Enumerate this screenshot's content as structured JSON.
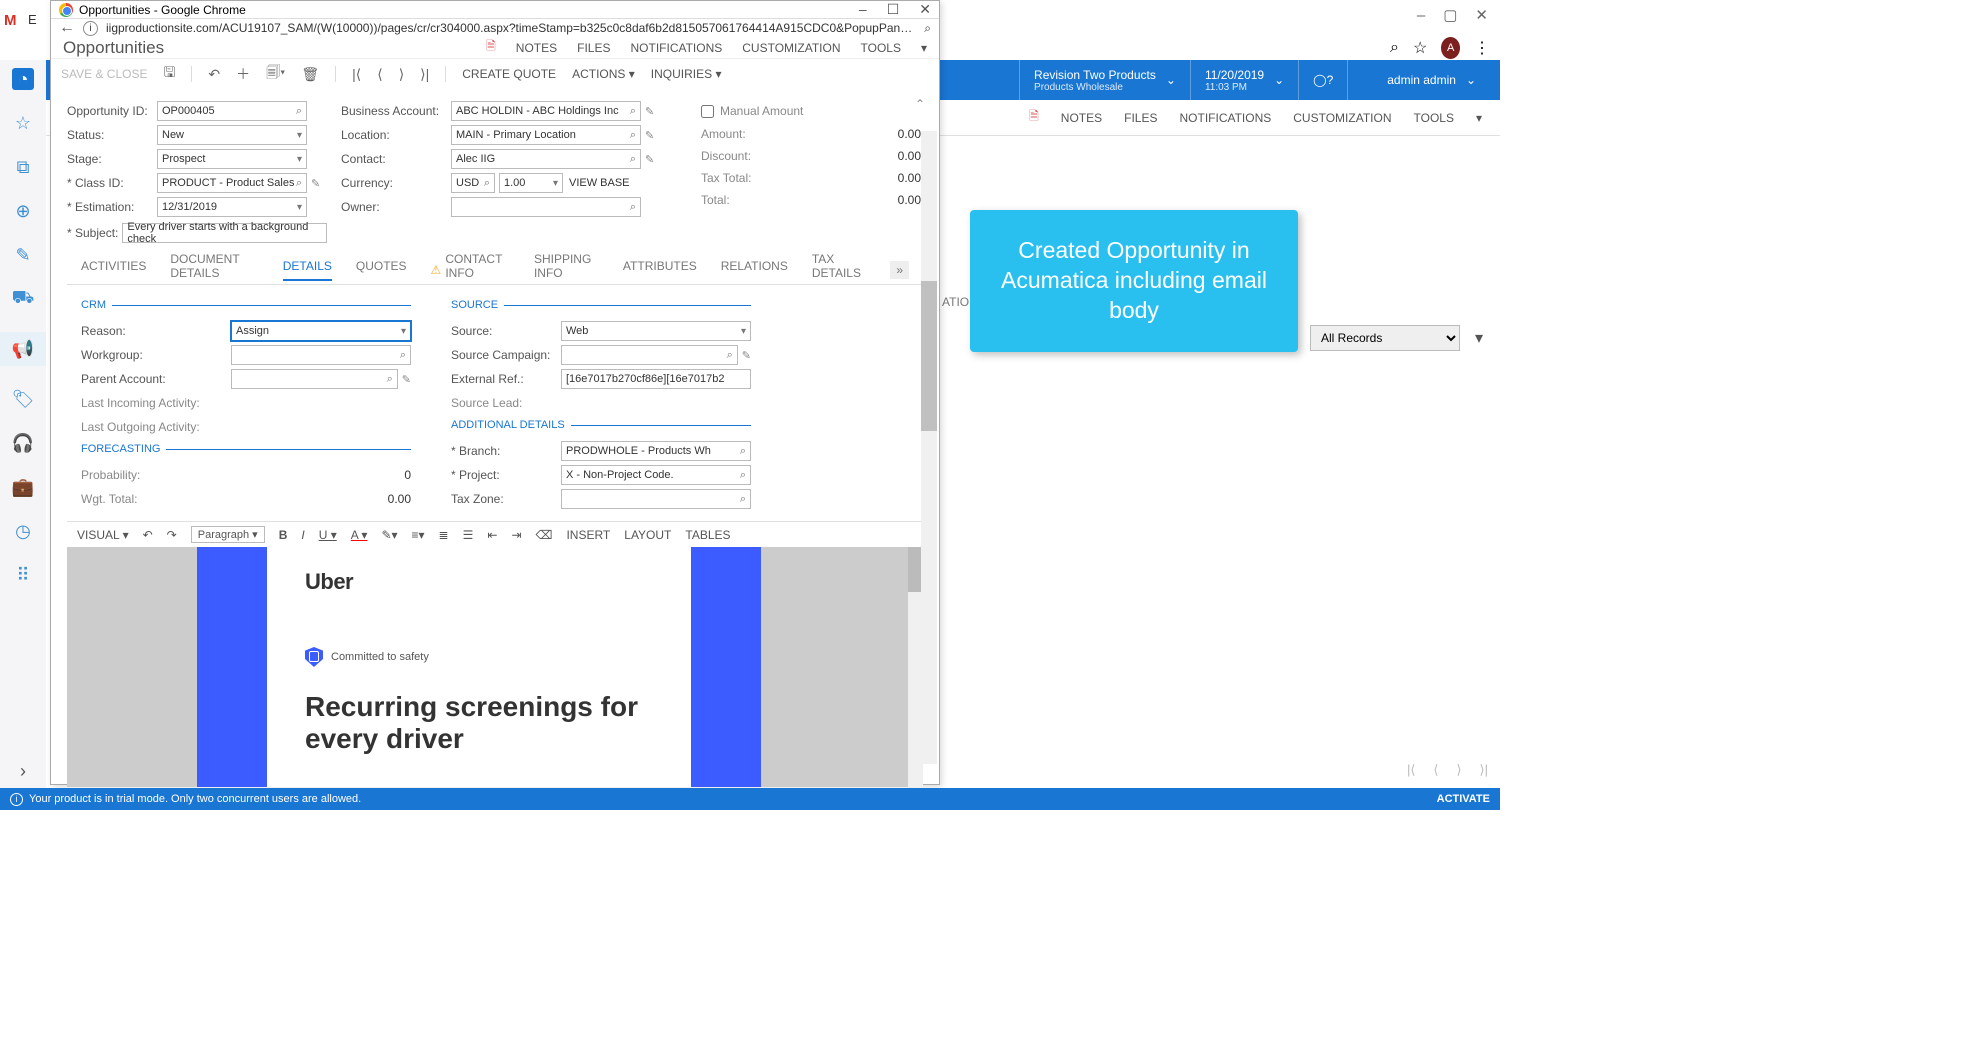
{
  "bg": {
    "company_name": "Revision Two Products",
    "company_sub": "Products Wholesale",
    "date": "11/20/2019",
    "time": "11:03 PM",
    "user": "admin admin",
    "tabs": {
      "notes": "NOTES",
      "files": "FILES",
      "notifications": "NOTIFICATIONS",
      "customization": "CUSTOMIZATION",
      "tools": "TOOLS"
    },
    "filter_all": "All Records",
    "ations": "ATIONS"
  },
  "gmail": {
    "m": "M",
    "e": "E"
  },
  "popup": {
    "title": "Opportunities - Google Chrome",
    "url": "iigproductionsite.com/ACU19107_SAM/(W(10000))/pages/cr/cr304000.aspx?timeStamp=b325c0c8daf6b2d815057061764414A915CDC0&PopupPanel=..."
  },
  "screen": {
    "title": "Opportunities",
    "links": {
      "notes": "NOTES",
      "files": "FILES",
      "notifications": "NOTIFICATIONS",
      "customization": "CUSTOMIZATION",
      "tools": "TOOLS"
    }
  },
  "toolbar": {
    "save_close": "SAVE & CLOSE",
    "create_quote": "CREATE QUOTE",
    "actions": "ACTIONS",
    "inquiries": "INQUIRIES"
  },
  "form": {
    "labels": {
      "opp_id": "Opportunity ID:",
      "status": "Status:",
      "stage": "Stage:",
      "class_id": "* Class ID:",
      "estimation": "* Estimation:",
      "subject": "* Subject:",
      "biz_acct": "Business Account:",
      "location": "Location:",
      "contact": "Contact:",
      "currency": "Currency:",
      "owner": "Owner:",
      "manual": "Manual Amount",
      "amount": "Amount:",
      "discount": "Discount:",
      "tax_total": "Tax Total:",
      "total": "Total:",
      "view_base": "VIEW BASE"
    },
    "values": {
      "opp_id": "OP000405",
      "status": "New",
      "stage": "Prospect",
      "class_id": "PRODUCT - Product Sales O",
      "estimation": "12/31/2019",
      "subject": "Every driver starts with a background check",
      "biz_acct": "ABC HOLDIN - ABC Holdings Inc",
      "location": "MAIN - Primary Location",
      "contact": "Alec IIG",
      "currency": "USD",
      "rate": "1.00",
      "amount": "0.00",
      "discount": "0.00",
      "tax_total": "0.00",
      "total": "0.00"
    }
  },
  "tabs": {
    "activities": "ACTIVITIES",
    "doc_details": "DOCUMENT DETAILS",
    "details": "DETAILS",
    "quotes": "QUOTES",
    "contact_info": "CONTACT INFO",
    "shipping": "SHIPPING INFO",
    "attributes": "ATTRIBUTES",
    "relations": "RELATIONS",
    "tax_details": "TAX DETAILS"
  },
  "details": {
    "crm": "CRM",
    "forecasting": "FORECASTING",
    "source": "SOURCE",
    "additional": "ADDITIONAL DETAILS",
    "labels": {
      "reason": "Reason:",
      "workgroup": "Workgroup:",
      "parent_acct": "Parent Account:",
      "last_in": "Last Incoming Activity:",
      "last_out": "Last Outgoing Activity:",
      "probability": "Probability:",
      "wgt_total": "Wgt. Total:",
      "src": "Source:",
      "src_campaign": "Source Campaign:",
      "ext_ref": "External Ref.:",
      "src_lead": "Source Lead:",
      "branch": "* Branch:",
      "project": "* Project:",
      "tax_zone": "Tax Zone:"
    },
    "values": {
      "reason": "Assign",
      "probability": "0",
      "wgt_total": "0.00",
      "src": "Web",
      "ext_ref": "[16e7017b270cf86e][16e7017b2",
      "branch": "PRODWHOLE - Products Wh",
      "project": "X - Non-Project Code."
    }
  },
  "rte": {
    "visual": "VISUAL",
    "paragraph": "Paragraph",
    "insert": "INSERT",
    "layout": "LAYOUT",
    "tables": "TABLES",
    "uber": "Uber",
    "safety": "Committed to safety",
    "headline": "Recurring screenings for every driver"
  },
  "callout": "Created Opportunity in Acumatica including email body",
  "trial": {
    "msg": "Your product is in trial mode. Only two concurrent users are allowed.",
    "activate": "ACTIVATE"
  }
}
